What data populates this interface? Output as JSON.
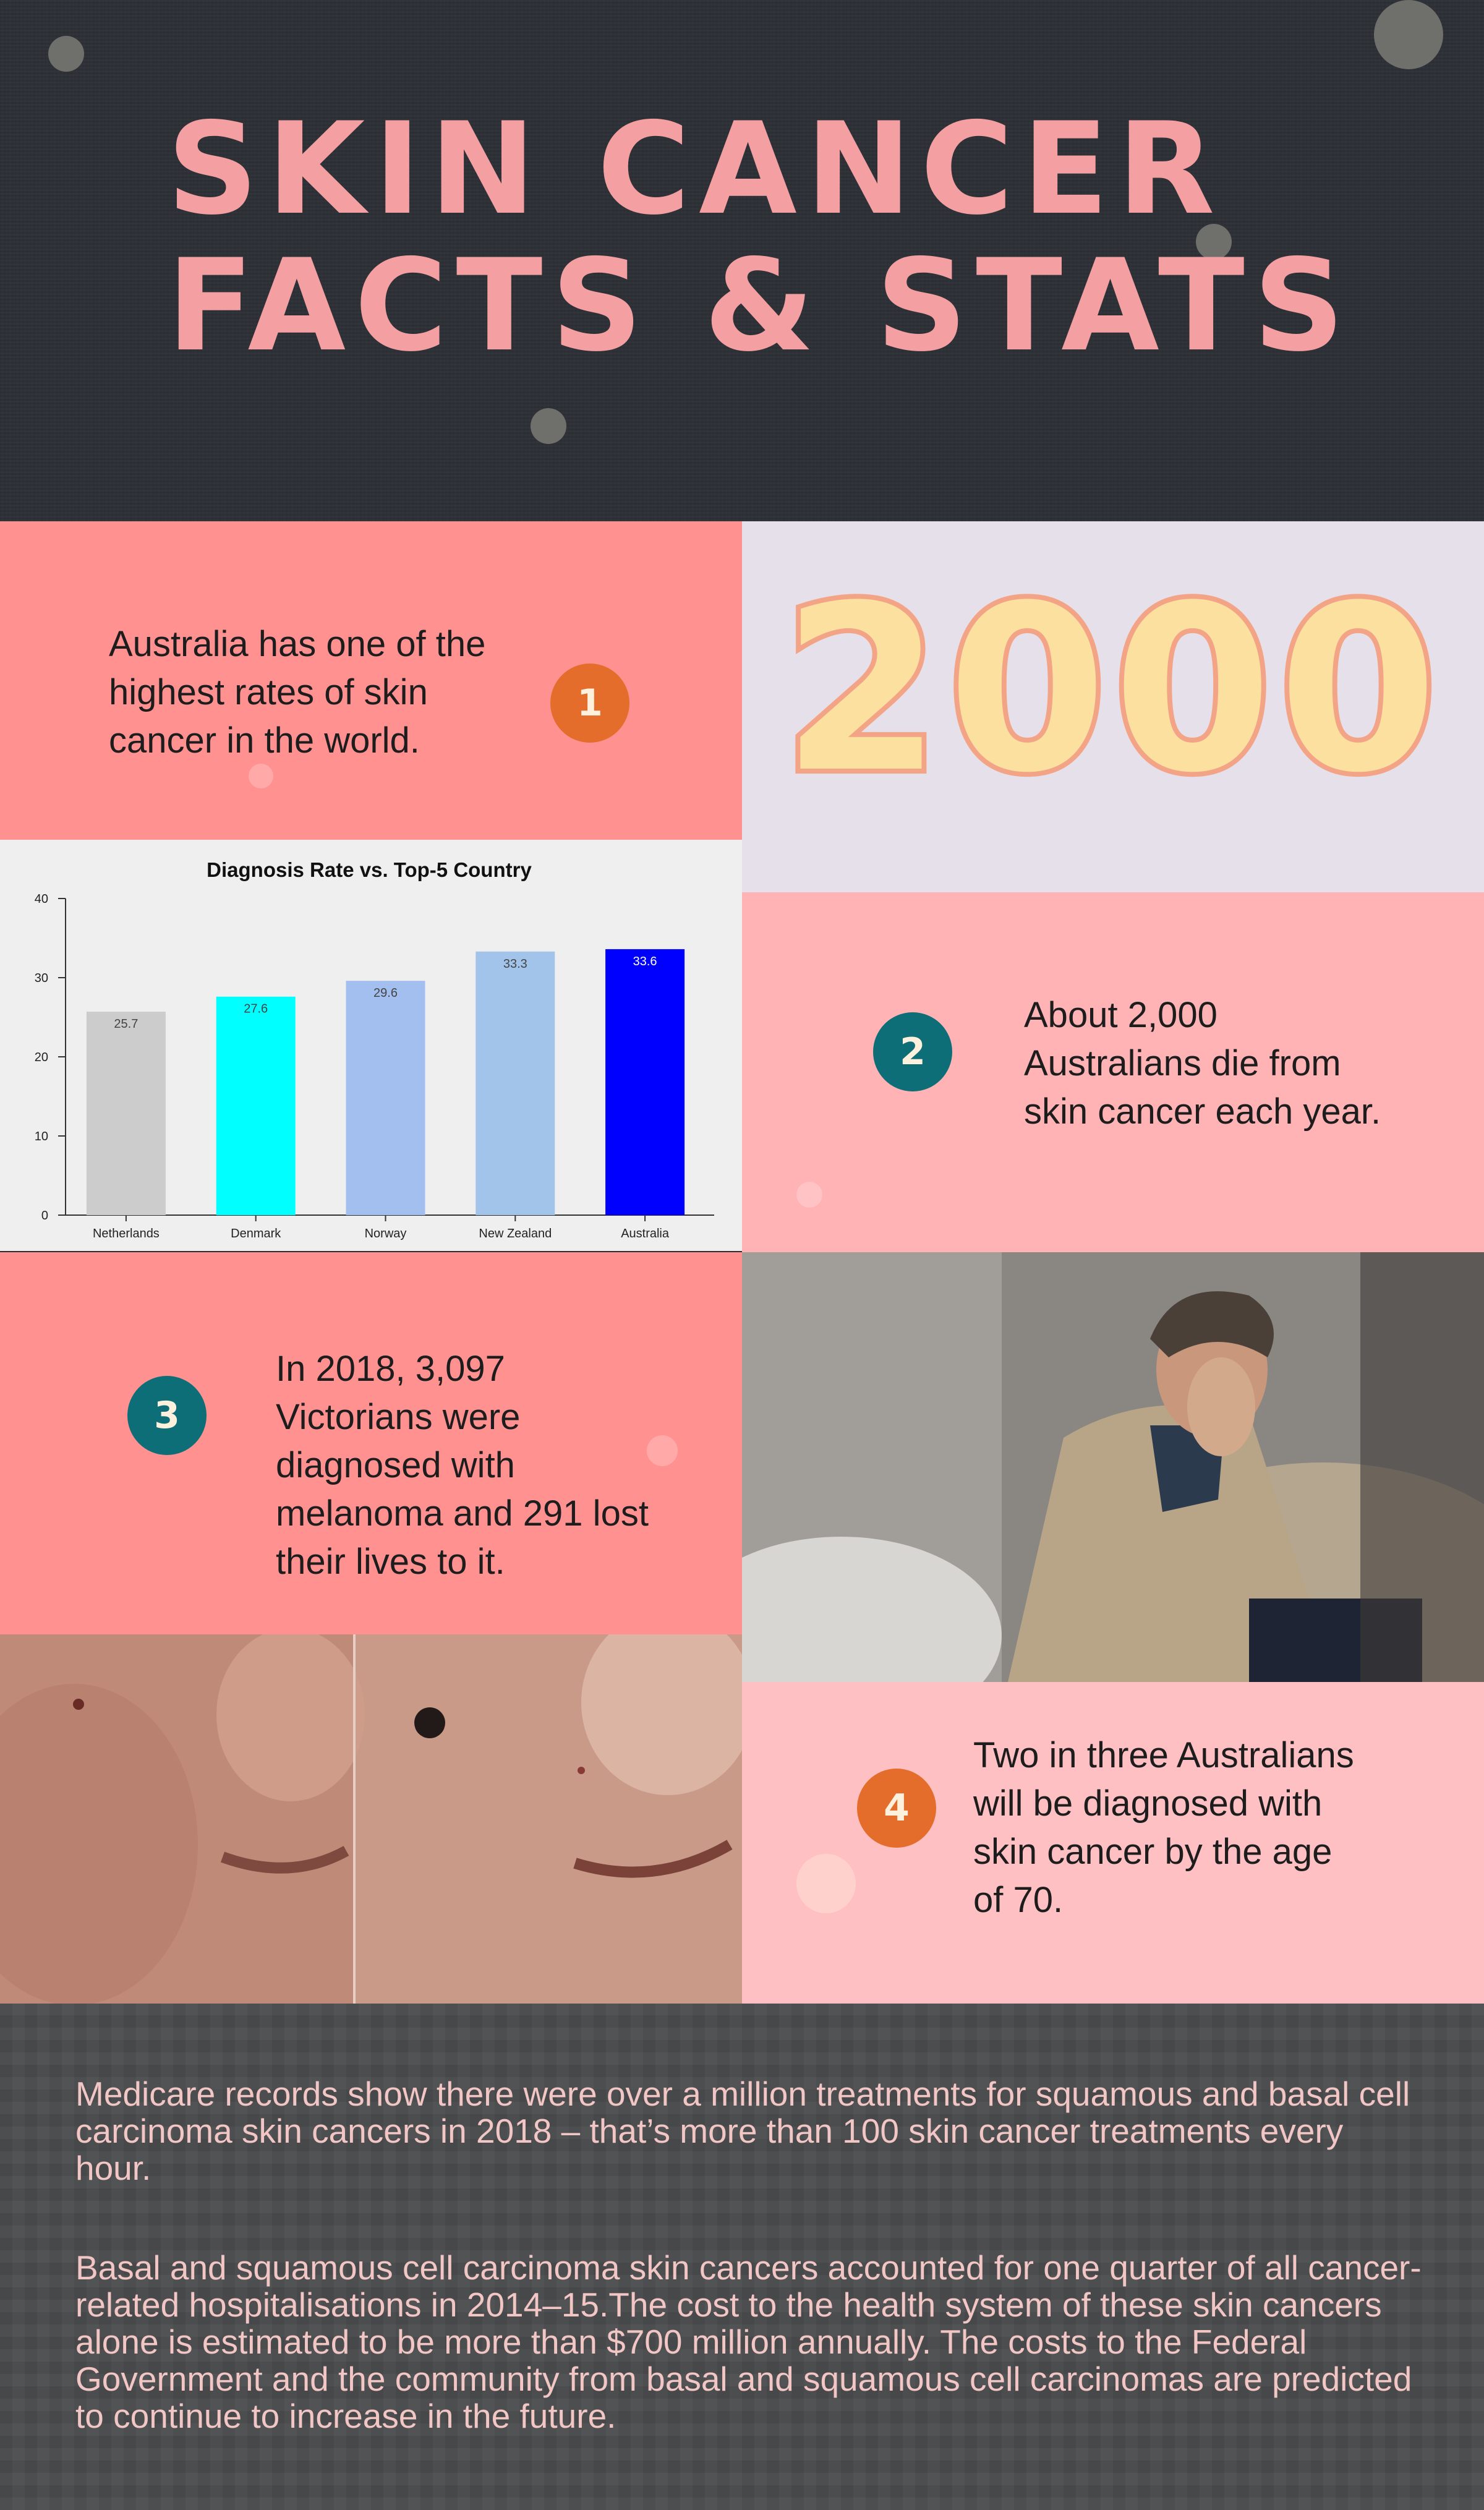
{
  "header": {
    "title_line1": "SKIN CANCER",
    "title_line2": "FACTS & STATS"
  },
  "big_number": "2000",
  "facts": [
    {
      "number": "1",
      "text": "Australia has one of the\nhighest rates of skin\ncancer in the world."
    },
    {
      "number": "2",
      "text": "About 2,000\nAustralians die from\nskin cancer each year."
    },
    {
      "number": "3",
      "text": "In 2018, 3,097\nVictorians were\ndiagnosed with\nmelanoma and 291 lost\ntheir lives to it."
    },
    {
      "number": "4",
      "text": "Two in three Australians\nwill be diagnosed with\nskin cancer by the age\nof 70."
    }
  ],
  "chart_data": {
    "type": "bar",
    "title": "Diagnosis Rate vs. Top-5 Country",
    "categories": [
      "Netherlands",
      "Denmark",
      "Norway",
      "New Zealand",
      "Australia"
    ],
    "values": [
      25.7,
      27.6,
      29.6,
      33.3,
      33.6
    ],
    "value_labels": [
      "25.7",
      "27.6",
      "29.6",
      "33.3",
      "33.6"
    ],
    "colors": [
      "#cccccc",
      "#00ffff",
      "#a3bff0",
      "#a3c4ea",
      "#0000ff"
    ],
    "label_colors": [
      "#444444",
      "#444444",
      "#444444",
      "#444444",
      "#ffffff"
    ],
    "ylim": [
      0,
      40
    ],
    "yticks": [
      0,
      10,
      20,
      30,
      40
    ],
    "xlabel": "",
    "ylabel": "",
    "grid": false
  },
  "footer": {
    "paragraph1": "Medicare records show there were over a million treatments for squamous and basal cell carcinoma skin cancers in 2018 – that’s more than 100 skin cancer treatments every hour.",
    "paragraph2": "Basal and squamous cell carcinoma skin cancers accounted for one quarter of all cancer-related hospitalisations in 2014–15.The cost to the health system of these skin cancers alone is estimated to be more than $700 million annually. The costs to the Federal Government and the community from basal and squamous cell carcinomas are predicted to continue to increase in the future."
  },
  "colors": {
    "title_pink": "#f4a0a2",
    "salmon_panel": "#ff9191",
    "pink_panel": "#ffb3b5",
    "light_pink_panel": "#ffc0c3",
    "lavender_panel": "#e6e0eb",
    "badge_orange": "#e56d2c",
    "badge_teal": "#0e6e78"
  }
}
